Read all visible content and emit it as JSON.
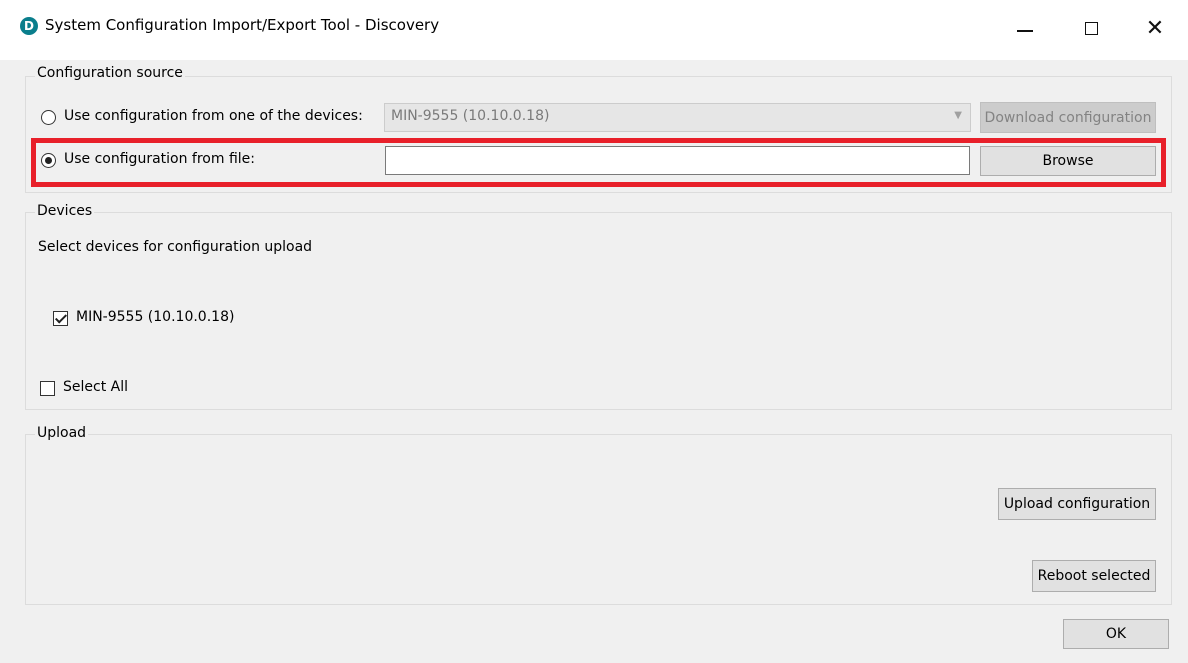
{
  "window": {
    "title": "System Configuration Import/Export Tool - Discovery",
    "app_icon_letter": "D",
    "controls": {
      "minimize": "",
      "maximize": "",
      "close": "✕"
    }
  },
  "config_source": {
    "group_label": "Configuration source",
    "option_devices_label": "Use configuration from one of the devices:",
    "option_devices_selected": false,
    "device_combo_value": "MIN-9555 (10.10.0.18)",
    "download_button_label": "Download configuration",
    "option_file_label": "Use configuration from file:",
    "option_file_selected": true,
    "file_path_value": "",
    "browse_button_label": "Browse"
  },
  "devices": {
    "group_label": "Devices",
    "instruction": "Select devices for configuration upload",
    "items": [
      {
        "label": "MIN-9555 (10.10.0.18)",
        "checked": true
      }
    ],
    "select_all_label": "Select All",
    "select_all_checked": false
  },
  "upload": {
    "group_label": "Upload",
    "upload_button_label": "Upload configuration",
    "reboot_button_label": "Reboot selected"
  },
  "footer": {
    "ok_button_label": "OK"
  },
  "colors": {
    "highlight": "#e8202a",
    "app_icon": "#0a7e8c"
  }
}
